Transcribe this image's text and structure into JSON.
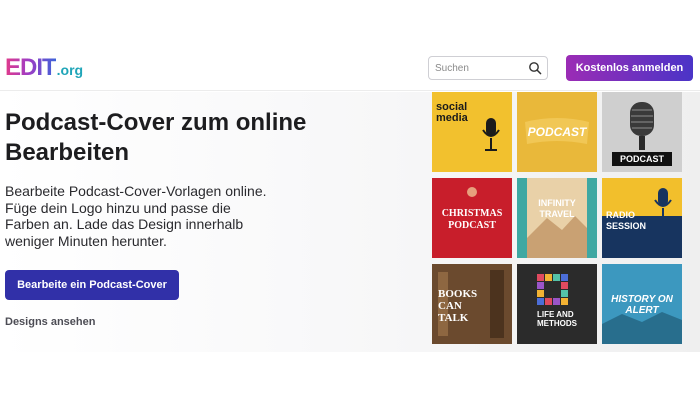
{
  "logo": {
    "main": "EDIT",
    "suffix": ".org"
  },
  "search": {
    "placeholder": "Suchen"
  },
  "header": {
    "signup_label": "Kostenlos anmelden"
  },
  "hero": {
    "title": "Podcast-Cover zum online Bearbeiten",
    "description": "Bearbeite Podcast-Cover-Vorlagen online. Füge dein Logo hinzu und passe die Farben an. Lade das Design innerhalb weniger Minuten herunter.",
    "cta_label": "Bearbeite ein Podcast-Cover",
    "secondary_link": "Designs ansehen"
  },
  "gallery": {
    "tiles": [
      {
        "label": "social media",
        "bg": "#f2c12e",
        "fg": "#1b1b1b"
      },
      {
        "label": "PODCAST",
        "bg": "#e9b83a",
        "fg": "#ffffff"
      },
      {
        "label": "PODCAST",
        "bg": "#d9d9d9",
        "fg": "#ffffff"
      },
      {
        "label": "CHRISTMAS PODCAST",
        "bg": "#c81e2b",
        "fg": "#ffffff"
      },
      {
        "label": "INFINITY TRAVEL",
        "bg": "#3fa8a2",
        "fg": "#ffffff"
      },
      {
        "label": "RADIO SESSION",
        "bg": "#17345f",
        "fg": "#ffffff"
      },
      {
        "label": "BOOKS CAN TALK",
        "bg": "#5a3c25",
        "fg": "#ffffff"
      },
      {
        "label": "LIFE AND METHODS",
        "bg": "#2b2b2b",
        "fg": "#ffffff"
      },
      {
        "label": "HISTORY ON ALERT",
        "bg": "#2f8fb7",
        "fg": "#ffffff"
      }
    ]
  },
  "colors": {
    "brand_gradient_start": "#9b2cb5",
    "brand_gradient_end": "#4a34c7",
    "cta": "#3130a8"
  }
}
